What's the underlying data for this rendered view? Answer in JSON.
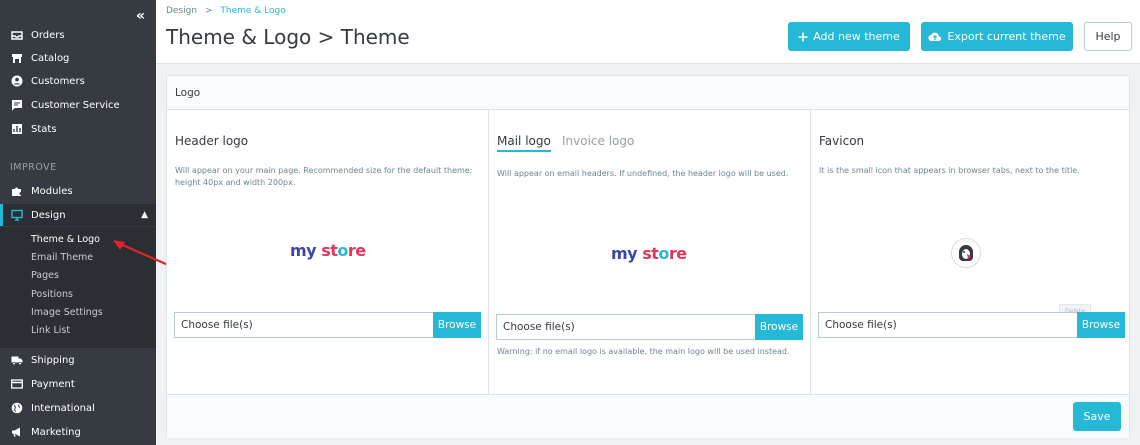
{
  "sidebar": {
    "top_items": [
      {
        "label": "Orders",
        "icon": "inbox-icon"
      },
      {
        "label": "Catalog",
        "icon": "store-icon"
      },
      {
        "label": "Customers",
        "icon": "account-icon"
      },
      {
        "label": "Customer Service",
        "icon": "chat-icon"
      },
      {
        "label": "Stats",
        "icon": "chart-icon"
      }
    ],
    "section_label": "IMPROVE",
    "improve_items": [
      {
        "label": "Modules",
        "icon": "puzzle-icon"
      },
      {
        "label": "Design",
        "icon": "desktop-icon"
      }
    ],
    "design_submenu": [
      "Theme & Logo",
      "Email Theme",
      "Pages",
      "Positions",
      "Image Settings",
      "Link List"
    ],
    "bottom_items": [
      {
        "label": "Shipping",
        "icon": "truck-icon"
      },
      {
        "label": "Payment",
        "icon": "credit-card-icon"
      },
      {
        "label": "International",
        "icon": "globe-icon"
      },
      {
        "label": "Marketing",
        "icon": "megaphone-icon"
      }
    ],
    "collapse_glyph": "«"
  },
  "header": {
    "breadcrumb_parent": "Design",
    "breadcrumb_sep": ">",
    "breadcrumb_current": "Theme & Logo",
    "title": "Theme & Logo > Theme",
    "add_theme_label": "Add new theme",
    "export_theme_label": "Export current theme",
    "help_label": "Help"
  },
  "card": {
    "title": "Logo",
    "header_logo": {
      "title": "Header logo",
      "help": "Will appear on your main page. Recommended size for the default theme: height 40px and width 200px.",
      "file_placeholder": "Choose file(s)",
      "browse_label": "Browse"
    },
    "mail_logo": {
      "tab_mail": "Mail logo",
      "tab_invoice": "Invoice logo",
      "help": "Will appear on email headers. If undefined, the header logo will be used.",
      "file_placeholder": "Choose file(s)",
      "browse_label": "Browse",
      "warning": "Warning: if no email logo is available, the main logo will be used instead."
    },
    "favicon": {
      "title": "Favicon",
      "help": "It is the small icon that appears in browser tabs, next to the title.",
      "file_placeholder": "Choose file(s)",
      "browse_label": "Browse",
      "small_button": "Delete"
    },
    "save_label": "Save"
  },
  "logo_text": {
    "part1": "my",
    "part2": "st",
    "part3": "o",
    "part4": "re"
  },
  "colors": {
    "accent": "#25b9d7",
    "sidebar": "#363a41",
    "arrow": "#e0242a"
  }
}
